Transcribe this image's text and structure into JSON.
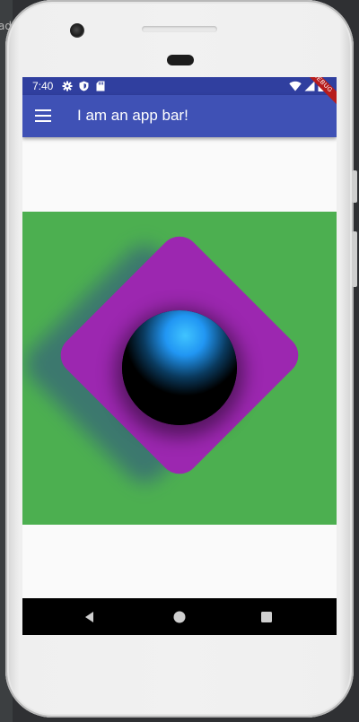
{
  "backdrop": {
    "text": "ad"
  },
  "status_bar": {
    "time": "7:40",
    "icons": [
      "settings-icon",
      "shield-icon",
      "sd-card-icon",
      "wifi-icon",
      "signal-icon",
      "battery-icon"
    ]
  },
  "app_bar": {
    "title": "I am an app bar!",
    "menu_icon": "menu-icon"
  },
  "debug_banner": {
    "label": "DEBUG"
  },
  "content": {
    "panel_color": "#4caf50",
    "diamond_color": "#9c27b0",
    "sphere_highlight": "#40c4ff"
  },
  "nav_bar": {
    "buttons": [
      "back-icon",
      "home-icon",
      "recents-icon"
    ]
  },
  "colors": {
    "status_bar": "#303f9f",
    "app_bar": "#3f51b5",
    "background": "#fafafa",
    "debug": "#b71c1c"
  }
}
